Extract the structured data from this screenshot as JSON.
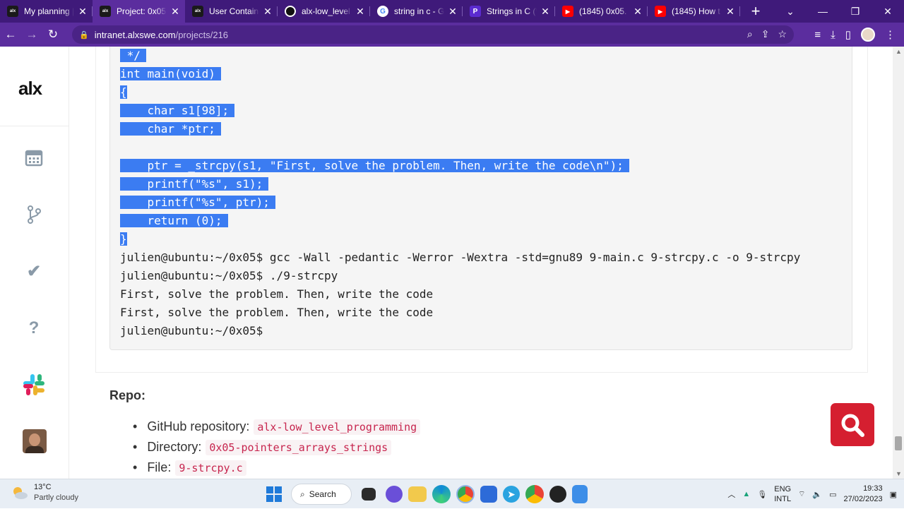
{
  "tabs": [
    {
      "title": "My planning |",
      "favicon": "alx",
      "color": "#1a1a1a"
    },
    {
      "title": "Project: 0x05",
      "favicon": "alx",
      "color": "#1a1a1a",
      "active": true
    },
    {
      "title": "User Contain",
      "favicon": "alx",
      "color": "#1a1a1a"
    },
    {
      "title": "alx-low_level",
      "favicon": "github",
      "color": "#111111"
    },
    {
      "title": "string in c - G",
      "favicon": "G",
      "color": "#ffffff"
    },
    {
      "title": "Strings in C (\\",
      "favicon": "P",
      "color": "#5b2bd0"
    },
    {
      "title": "(1845) 0x05. (",
      "favicon": "yt",
      "color": "#ff0000"
    },
    {
      "title": "(1845) How t",
      "favicon": "yt",
      "color": "#ff0000"
    }
  ],
  "url": {
    "host": "intranet.alxswe.com",
    "path": "/projects/216"
  },
  "sidebar": {
    "logo": "alx"
  },
  "code_lines": [
    {
      "text": " */",
      "selected": true
    },
    {
      "text": "int main(void)",
      "selected": true
    },
    {
      "text": "{",
      "selected": true
    },
    {
      "text": "    char s1[98];",
      "selected": true
    },
    {
      "text": "    char *ptr;",
      "selected": true
    },
    {
      "text": "",
      "selected": true
    },
    {
      "text": "    ptr = _strcpy(s1, \"First, solve the problem. Then, write the code\\n\");",
      "selected": true
    },
    {
      "text": "    printf(\"%s\", s1);",
      "selected": true
    },
    {
      "text": "    printf(\"%s\", ptr);",
      "selected": true
    },
    {
      "text": "    return (0);",
      "selected": true
    },
    {
      "text": "}",
      "selected": true
    },
    {
      "text": "julien@ubuntu:~/0x05$ gcc -Wall -pedantic -Werror -Wextra -std=gnu89 9-main.c 9-strcpy.c -o 9-strcpy",
      "selected": false
    },
    {
      "text": "julien@ubuntu:~/0x05$ ./9-strcpy",
      "selected": false
    },
    {
      "text": "First, solve the problem. Then, write the code",
      "selected": false
    },
    {
      "text": "First, solve the problem. Then, write the code",
      "selected": false
    },
    {
      "text": "julien@ubuntu:~/0x05$",
      "selected": false
    }
  ],
  "repo": {
    "heading": "Repo:",
    "items": [
      {
        "label": "GitHub repository:",
        "value": "alx-low_level_programming"
      },
      {
        "label": "Directory:",
        "value": "0x05-pointers_arrays_strings"
      },
      {
        "label": "File:",
        "value": "9-strcpy.c"
      }
    ]
  },
  "taskbar": {
    "weather_temp": "13°C",
    "weather_desc": "Partly cloudy",
    "search_label": "Search",
    "lang1": "ENG",
    "lang2": "INTL",
    "time": "19:33",
    "date": "27/02/2023"
  },
  "colors": {
    "brand_purple": "#5b2d9e",
    "selection": "#3b7cf2",
    "fab_red": "#d51f30"
  }
}
